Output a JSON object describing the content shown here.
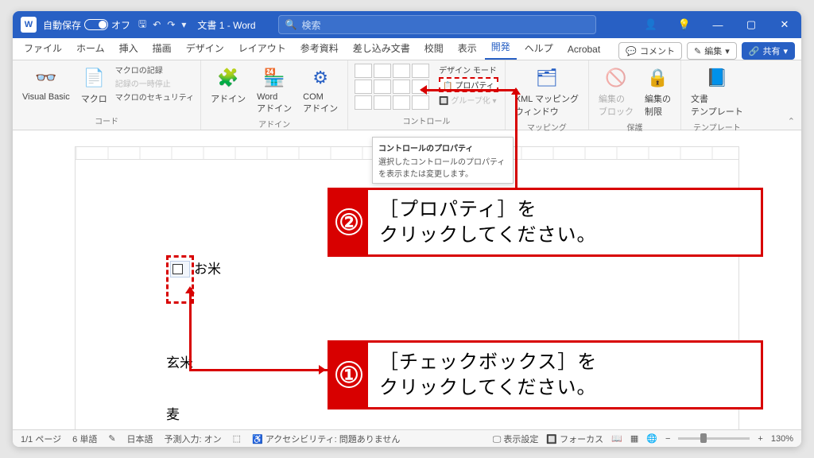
{
  "titlebar": {
    "autosave_label": "自動保存",
    "autosave_state": "オフ",
    "doc_title": "文書 1 - Word",
    "search_placeholder": "検索"
  },
  "tabs": {
    "items": [
      "ファイル",
      "ホーム",
      "挿入",
      "描画",
      "デザイン",
      "レイアウト",
      "参考資料",
      "差し込み文書",
      "校閲",
      "表示",
      "開発",
      "ヘルプ",
      "Acrobat"
    ],
    "active_index": 10,
    "comment_btn": "コメント",
    "edit_btn": "編集",
    "share_btn": "共有"
  },
  "ribbon": {
    "code": {
      "vb": "Visual Basic",
      "macro": "マクロ",
      "record": "マクロの記録",
      "pause": "記録の一時停止",
      "security": "マクロのセキュリティ",
      "label": "コード"
    },
    "addins": {
      "addin": "アドイン",
      "word": "Word\nアドイン",
      "com": "COM\nアドイン",
      "label": "アドイン"
    },
    "controls": {
      "design": "デザイン モード",
      "properties": "プロパティ",
      "group": "グループ化",
      "label": "コントロール"
    },
    "mapping": {
      "xml": "XML マッピング\nウィンドウ",
      "label": "マッピング"
    },
    "protect": {
      "block": "編集の\nブロック",
      "restrict": "編集の\n制限",
      "label": "保護"
    },
    "template": {
      "doc": "文書\nテンプレート",
      "label": "テンプレート"
    }
  },
  "tooltip": {
    "title": "コントロールのプロパティ",
    "body": "選択したコントロールのプロパティを表示または変更します。"
  },
  "document": {
    "row1": "お米",
    "row2": "玄米",
    "row3": "麦"
  },
  "callouts": {
    "c1": {
      "num": "①",
      "text": "［チェックボックス］を\nクリックしてください。"
    },
    "c2": {
      "num": "②",
      "text": "［プロパティ］を\nクリックしてください。"
    }
  },
  "statusbar": {
    "page": "1/1 ページ",
    "words": "6 単語",
    "lang": "日本語",
    "predict": "予測入力: オン",
    "access": "アクセシビリティ: 問題ありません",
    "display": "表示設定",
    "focus": "フォーカス",
    "zoom": "130%"
  }
}
